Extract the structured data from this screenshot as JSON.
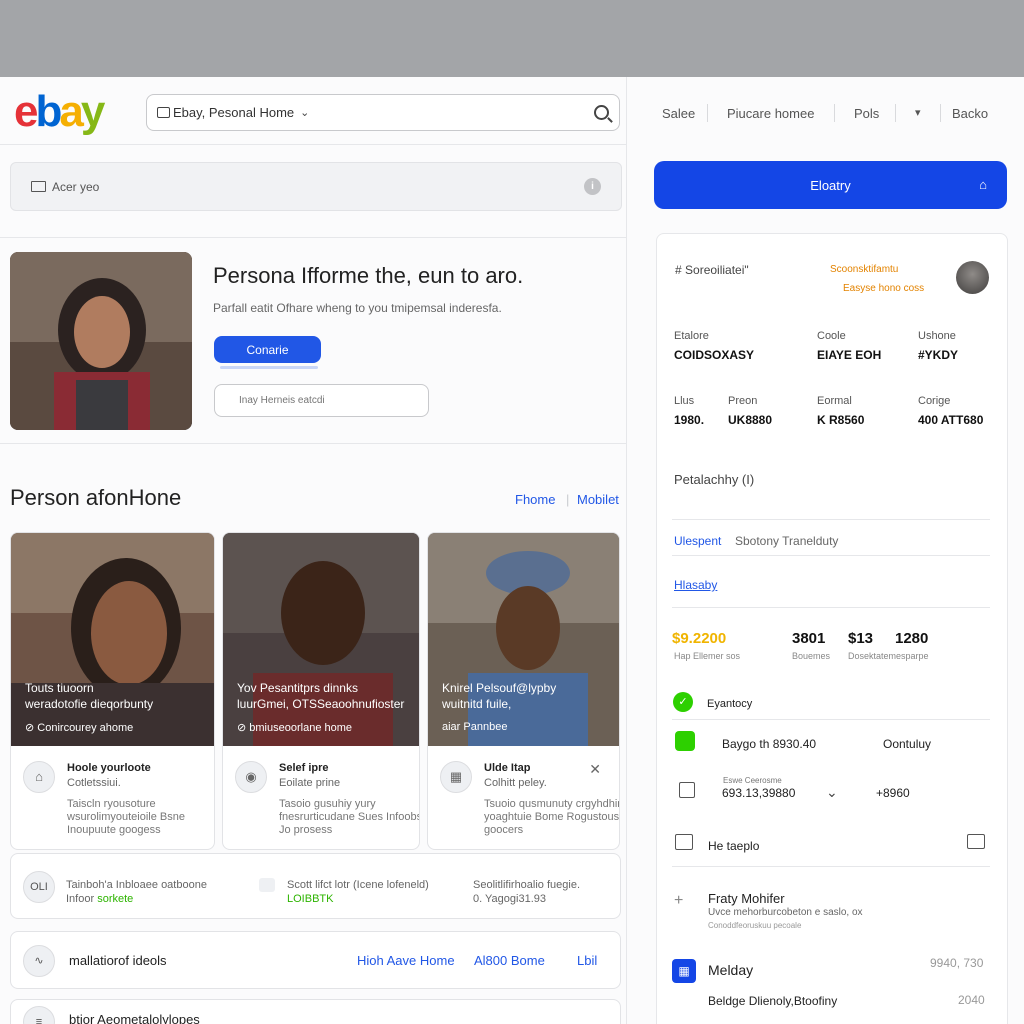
{
  "header": {
    "search_label": "Ebay, Pesonal Home",
    "nav": [
      "Salee",
      "Piucare homee",
      "Pols",
      "Backo"
    ]
  },
  "account_bar": {
    "label": "Acer yeo"
  },
  "hero": {
    "title": "Persona Ifforme the, eun to aro.",
    "subtitle": "Parfall eatit Ofhare wheng to you tmipemsal inderesfa.",
    "button": "Conarie",
    "input_placeholder": "Inay Herneis eatcdi"
  },
  "section": {
    "title": "Person afonHone",
    "links": [
      "Fhome",
      "Mobilet"
    ]
  },
  "cards": [
    {
      "overlay_title": "Touts tiuoorn",
      "overlay_sub": "weradotofie dieqorbunty",
      "overlay_link": "Conircourey ahome",
      "name": "Hoole yourloote",
      "sub": "Cotletssiui.",
      "desc": "Taiscln ryousoture wsurolimyouteioile Bsne Inoupuute googess",
      "icon": "image-icon"
    },
    {
      "overlay_title": "Yov Pesantitprs dinnks",
      "overlay_sub": "luurGmei, OTSSeaoohnufioster",
      "overlay_link": "bmiuseoorlane home",
      "name": "Selef ipre",
      "sub": "Eoilate prine",
      "desc": "Tasoio gusuhiy yury fnesrurticudane Sues Infoobsti Jo prosess",
      "icon": "camera-icon"
    },
    {
      "overlay_title": "Knirel Pelsouf@lypby",
      "overlay_sub": "wuitnitd fuile,",
      "overlay_link": "aiar Pannbee",
      "name": "Ulde Itap",
      "sub": "Colhitt peley.",
      "desc": "Tsuoio qusmunuty crgyhdhing yoaghtuie Bome Rogustous goocers",
      "icon": "grid-icon"
    }
  ],
  "info_row": {
    "icon_text": "OLI",
    "col1_line1": "Tainboh'a Inbloaee oatboone",
    "col1_line2": "Infoor",
    "col1_green": "sorkete",
    "col2_line1": "Scott lifct lotr (Icene lofeneld)",
    "col2_green": "LOIBBTK",
    "col3_line1": "Seolitlifirhoalio fuegie.",
    "col3_line2": "0. Yagogi31.93"
  },
  "link_row": {
    "title": "mallatiorof ideols",
    "links": [
      "Hioh Aave Home",
      "Al800 Bome",
      "Lbil"
    ]
  },
  "last_row": {
    "title": "btior Aeometalolylopes"
  },
  "sidebar": {
    "primary_button": "Eloatry",
    "profile_label": "Soreoiliatei\"",
    "promo_top": "Scoonsktifamtu",
    "promo_bottom": "Easyse hono coss",
    "stats_row1": [
      {
        "label": "Etalore",
        "value": "COIDSOXASY"
      },
      {
        "label": "Coole",
        "value": "EIAYE EOH"
      },
      {
        "label": "Ushone",
        "value": "#YKDY"
      }
    ],
    "stats_row2": [
      {
        "label": "Llus",
        "value": "1980."
      },
      {
        "label": "Preon",
        "value": "UK8880"
      },
      {
        "label": "Eormal",
        "value": "K R8560"
      },
      {
        "label": "Corige",
        "value": "400 ATT680"
      }
    ],
    "petal_label": "Petalachhy (I)",
    "tab_active": "Ulespent",
    "tab_other": "Sbotony Tranelduty",
    "link_has": "Hlasaby",
    "metrics": [
      {
        "value": "$9.2200",
        "label": "Hap Ellemer sos"
      },
      {
        "value": "3801",
        "label": "Bouemes"
      },
      {
        "value": "$13",
        "label": "Dosektatemesparpe"
      },
      {
        "value": "1280",
        "label": ""
      }
    ],
    "status_title": "Eyantocy",
    "status_line": "Baygo th 8930.40",
    "status_right": "Oontuluy",
    "amount_small": "Eswe Ceerosme",
    "amount": "693.13,39880",
    "amount_right": "+8960",
    "help_label": "He taeplo",
    "entry_title": "Fraty Mohifer",
    "entry_sub": "Uvce mehorburcobeton e saslo, ox",
    "entry_note": "Conoddfeoruskuu pecoale",
    "melday_title": "Melday",
    "melday_right": "9940, 730",
    "bottom_line": "Beldge Dlienoly,Btoofiny",
    "bottom_right": "2040"
  },
  "colors": {
    "accent": "#1446e6",
    "orange": "#e38300",
    "green": "#2db400"
  }
}
